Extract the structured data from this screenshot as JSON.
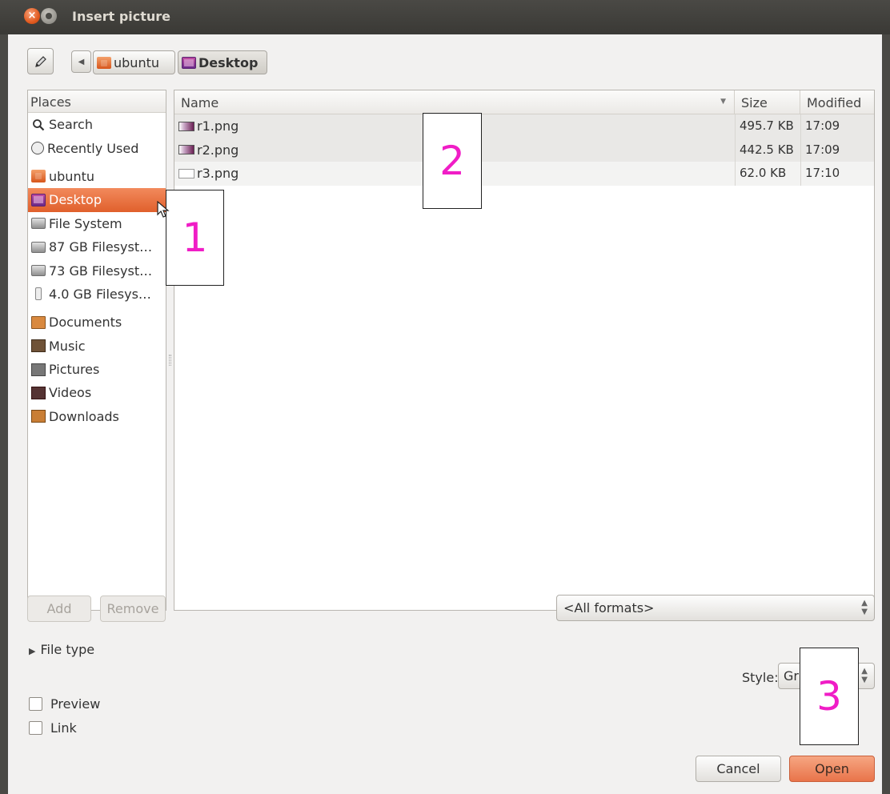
{
  "window": {
    "title": "Insert picture"
  },
  "toolbar": {
    "edit_icon": "pencil-icon",
    "back_icon": "left-arrow-icon",
    "breadcrumbs": [
      "ubuntu",
      "Desktop"
    ]
  },
  "places": {
    "header": "Places",
    "items": [
      {
        "label": "Search",
        "icon": "search-icon"
      },
      {
        "label": "Recently Used",
        "icon": "clock-icon"
      },
      {
        "label": "ubuntu",
        "icon": "home-folder-icon"
      },
      {
        "label": "Desktop",
        "icon": "desktop-icon",
        "selected": true
      },
      {
        "label": "File System",
        "icon": "drive-icon"
      },
      {
        "label": "87 GB Filesyst…",
        "icon": "drive-icon"
      },
      {
        "label": "73 GB Filesyst…",
        "icon": "drive-icon"
      },
      {
        "label": "4.0 GB Filesys…",
        "icon": "usb-drive-icon"
      },
      {
        "label": "Documents",
        "icon": "documents-folder-icon"
      },
      {
        "label": "Music",
        "icon": "music-folder-icon"
      },
      {
        "label": "Pictures",
        "icon": "pictures-folder-icon"
      },
      {
        "label": "Videos",
        "icon": "videos-folder-icon"
      },
      {
        "label": "Downloads",
        "icon": "downloads-folder-icon"
      }
    ],
    "add_label": "Add",
    "remove_label": "Remove"
  },
  "files": {
    "columns": {
      "name": "Name",
      "size": "Size",
      "modified": "Modified"
    },
    "rows": [
      {
        "name": "r1.png",
        "size": "495.7 KB",
        "modified": "17:09"
      },
      {
        "name": "r2.png",
        "size": "442.5 KB",
        "modified": "17:09"
      },
      {
        "name": "r3.png",
        "size": "62.0 KB",
        "modified": "17:10"
      }
    ]
  },
  "filter": {
    "selected": "<All formats>"
  },
  "file_type": {
    "label": "File type"
  },
  "style": {
    "label": "Style:",
    "value": "Gr"
  },
  "options": {
    "preview_label": "Preview",
    "link_label": "Link"
  },
  "actions": {
    "cancel_label": "Cancel",
    "open_label": "Open"
  },
  "annotations": [
    "1",
    "2",
    "3"
  ],
  "colors": {
    "accent": "#e8683a",
    "annotation": "#f01dc6",
    "title_bar": "#3c3b37"
  }
}
